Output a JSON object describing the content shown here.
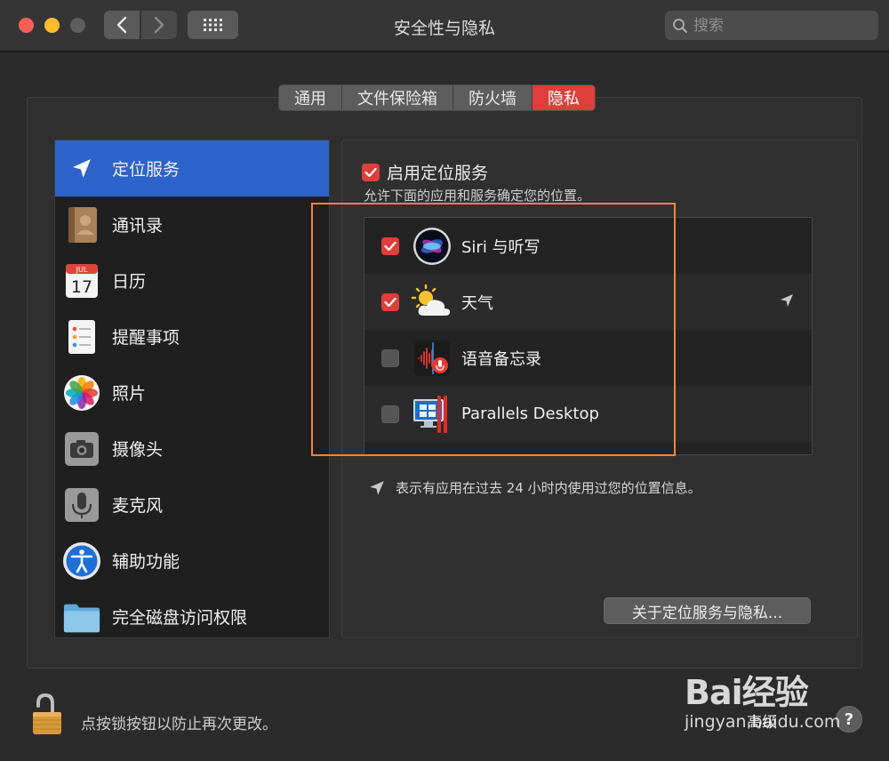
{
  "window": {
    "title": "安全性与隐私",
    "search_placeholder": "搜索"
  },
  "tabs": [
    {
      "label": "通用",
      "active": false
    },
    {
      "label": "文件保险箱",
      "active": false
    },
    {
      "label": "防火墙",
      "active": false
    },
    {
      "label": "隐私",
      "active": true
    }
  ],
  "sidebar": {
    "items": [
      {
        "label": "定位服务",
        "icon": "location-arrow-icon",
        "selected": true
      },
      {
        "label": "通讯录",
        "icon": "contacts-book-icon",
        "selected": false
      },
      {
        "label": "日历",
        "icon": "calendar-icon",
        "selected": false
      },
      {
        "label": "提醒事项",
        "icon": "reminders-icon",
        "selected": false
      },
      {
        "label": "照片",
        "icon": "photos-icon",
        "selected": false
      },
      {
        "label": "摄像头",
        "icon": "camera-icon",
        "selected": false
      },
      {
        "label": "麦克风",
        "icon": "microphone-icon",
        "selected": false
      },
      {
        "label": "辅助功能",
        "icon": "accessibility-icon",
        "selected": false
      },
      {
        "label": "完全磁盘访问权限",
        "icon": "folder-icon",
        "selected": false
      }
    ]
  },
  "location": {
    "enable_label": "启用定位服务",
    "enabled": true,
    "subtitle": "允许下面的应用和服务确定您的位置。",
    "apps": [
      {
        "name": "Siri 与听写",
        "checked": true,
        "icon": "siri-icon",
        "recent": false
      },
      {
        "name": "天气",
        "checked": true,
        "icon": "weather-icon",
        "recent": true
      },
      {
        "name": "语音备忘录",
        "checked": false,
        "icon": "voice-memos-icon",
        "recent": false
      },
      {
        "name": "Parallels Desktop",
        "checked": false,
        "icon": "parallels-icon",
        "recent": false
      }
    ],
    "note": "表示有应用在过去 24 小时内使用过您的位置信息。",
    "about_button": "关于定位服务与隐私..."
  },
  "footer": {
    "lock_text": "点按锁按钮以防止再次更改。",
    "advanced_label": "高级",
    "help_label": "?"
  },
  "watermark": {
    "logo": "Bai经验",
    "url": "jingyan.baidu.com"
  },
  "colors": {
    "accent_red": "#de3f3a",
    "selection_blue": "#2d63cb",
    "highlight_orange": "#f08537"
  }
}
